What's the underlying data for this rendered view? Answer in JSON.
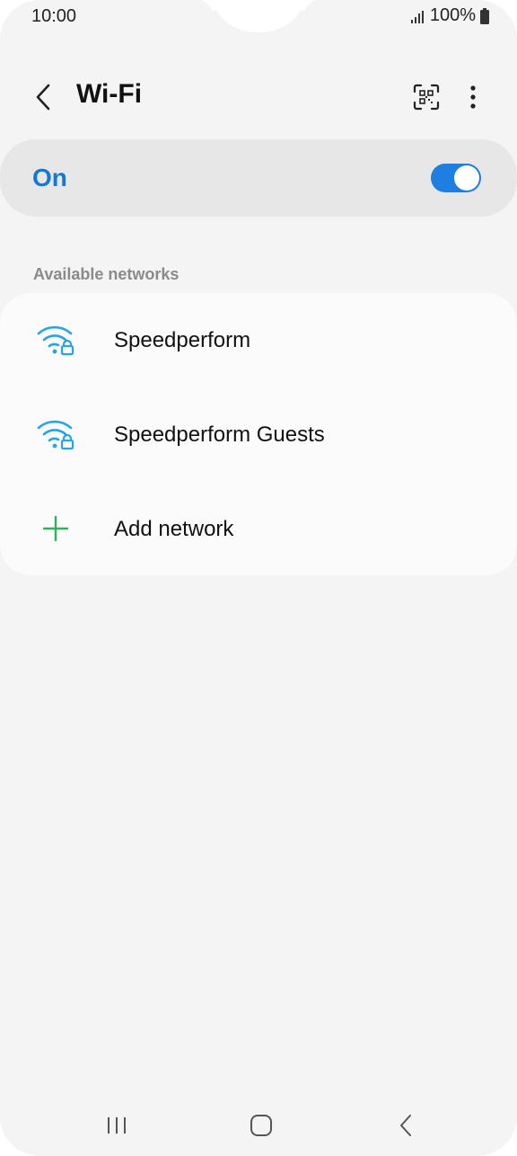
{
  "status_bar": {
    "time": "10:00",
    "battery": "100%",
    "icons": [
      "signal-icon",
      "battery-icon"
    ]
  },
  "header": {
    "title": "Wi-Fi",
    "icons": [
      "back-arrow-icon",
      "qr-code-scanner-icon",
      "more-options-icon"
    ]
  },
  "master_switch": {
    "label": "On",
    "state": "on",
    "accent_color": "#1f7fe0"
  },
  "networks": {
    "section_title": "Available networks",
    "items": [
      {
        "name": "Speedperform",
        "icon": "wifi-lock-icon",
        "secured": true
      },
      {
        "name": "Speedperform Guests",
        "icon": "wifi-lock-icon",
        "secured": true
      }
    ],
    "add_label": "Add network",
    "add_icon": "plus-icon"
  },
  "nav_bar": {
    "icons": [
      "recent-apps-icon",
      "home-icon",
      "back-icon"
    ]
  },
  "colors": {
    "accent": "#1478d4",
    "wifi_icon": "#29a3e8",
    "add_icon": "#2fb35a",
    "background": "#f4f4f4"
  }
}
